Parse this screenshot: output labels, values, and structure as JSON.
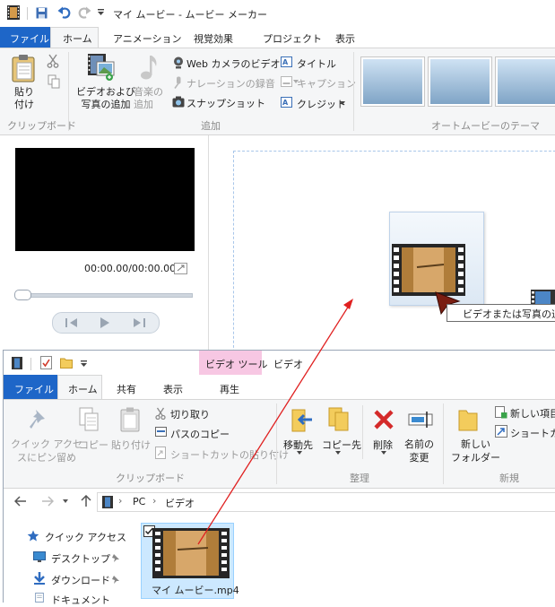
{
  "moviemaker": {
    "title": "マイ ムービー - ムービー メーカー",
    "tabs": [
      "ファイル",
      "ホーム",
      "アニメーション",
      "視覚効果",
      "プロジェクト",
      "表示"
    ],
    "clipboard": {
      "paste": "貼り\n付け",
      "group": "クリップボード"
    },
    "add": {
      "add_video_photo": "ビデオおよび\n写真の追加",
      "add_music": "音楽の\n追加",
      "webcam_video": "Web カメラのビデオ",
      "narration": "ナレーションの録音",
      "snapshot": "スナップショット",
      "title": "タイトル",
      "caption": "キャプション",
      "credits": "クレジット",
      "group": "追加"
    },
    "automovie_group": "オートムービーのテーマ",
    "player": {
      "time": "00:00.00/00:00.00"
    },
    "drag_tooltip": "ビデオまたは写真の追加"
  },
  "explorer": {
    "context_tab": "ビデオ ツール",
    "title": "ビデオ",
    "tabs": [
      "ファイル",
      "ホーム",
      "共有",
      "表示",
      "再生"
    ],
    "clipboard": {
      "pin": "クイック アクセ\nスにピン留め",
      "copy": "コピー",
      "paste": "貼り付け",
      "cut": "切り取り",
      "copy_path": "パスのコピー",
      "paste_shortcut": "ショートカットの貼り付け",
      "group": "クリップボード"
    },
    "organize": {
      "move_to": "移動先",
      "copy_to": "コピー先",
      "delete": "削除",
      "rename": "名前の\n変更",
      "group": "整理"
    },
    "new": {
      "new_folder": "新しい\nフォルダー",
      "new_item": "新しい項目",
      "shortcut": "ショートカット",
      "group": "新規"
    },
    "path": [
      "PC",
      "ビデオ"
    ],
    "nav": [
      "クイック アクセス",
      "デスクトップ",
      "ダウンロード",
      "ドキュメント"
    ],
    "file": {
      "name": "マイ ムービー.mp4"
    }
  }
}
